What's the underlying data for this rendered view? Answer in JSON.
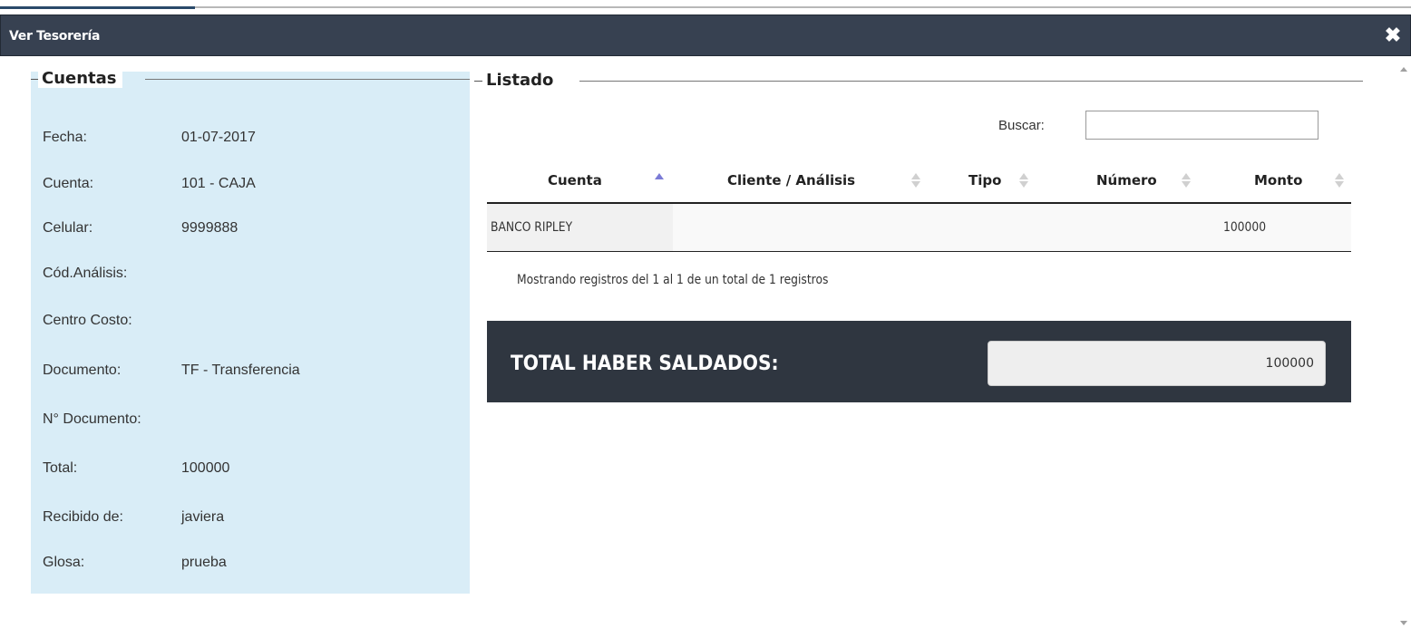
{
  "dialog": {
    "title": "Ver Tesorería",
    "close_glyph": "✖"
  },
  "cuentas": {
    "legend": "Cuentas",
    "fields": [
      {
        "label": "Fecha:",
        "value": "01-07-2017"
      },
      {
        "label": "Cuenta:",
        "value": "101 - CAJA"
      },
      {
        "label": "Celular:",
        "value": "9999888"
      },
      {
        "label": "Cód.Análisis:",
        "value": ""
      },
      {
        "label": "Centro Costo:",
        "value": ""
      },
      {
        "label": "Documento:",
        "value": "TF - Transferencia"
      },
      {
        "label": "N° Documento:",
        "value": ""
      },
      {
        "label": "Total:",
        "value": "100000"
      },
      {
        "label": "Recibido de:",
        "value": "javiera"
      },
      {
        "label": "Glosa:",
        "value": "prueba"
      }
    ]
  },
  "listado": {
    "legend": "Listado",
    "search_label": "Buscar:",
    "search_value": "",
    "columns": [
      "Cuenta",
      "Cliente / Análisis",
      "Tipo",
      "Número",
      "Monto"
    ],
    "sorted_column": "Cuenta",
    "rows": [
      {
        "cuenta": "BANCO RIPLEY",
        "cliente": "",
        "tipo": "",
        "numero": "",
        "monto": "100000"
      }
    ],
    "info": "Mostrando registros del 1 al 1 de un total de 1 registros",
    "total_label": "TOTAL HABER SALDADOS:",
    "total_value": "100000"
  },
  "colors": {
    "titlebar": "#374151",
    "cuentas_bg": "#d9edf7",
    "total_bar": "#2f3640",
    "sort_active": "#7b7bd6"
  }
}
